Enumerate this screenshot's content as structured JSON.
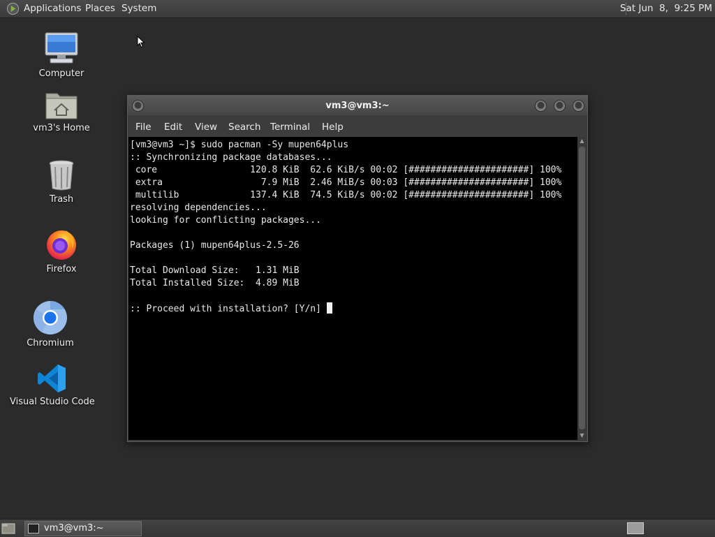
{
  "top_panel": {
    "menus": [
      "Applications",
      "Places",
      "System"
    ],
    "clock": "Sat Jun  8,  9:25 PM"
  },
  "desktop_icons": [
    {
      "label": "Computer",
      "icon": "computer-icon"
    },
    {
      "label": "vm3's Home",
      "icon": "home-folder-icon"
    },
    {
      "label": "Trash",
      "icon": "trash-icon"
    },
    {
      "label": "Firefox",
      "icon": "firefox-icon"
    },
    {
      "label": "Chromium",
      "icon": "chromium-icon"
    },
    {
      "label": "Visual Studio Code",
      "icon": "vscode-icon"
    }
  ],
  "window": {
    "title": "vm3@vm3:~",
    "menu": [
      "File",
      "Edit",
      "View",
      "Search",
      "Terminal",
      "Help"
    ],
    "terminal_lines": [
      "[vm3@vm3 ~]$ sudo pacman -Sy mupen64plus",
      ":: Synchronizing package databases...",
      " core                 120.8 KiB  62.6 KiB/s 00:02 [######################] 100%",
      " extra                  7.9 MiB  2.46 MiB/s 00:03 [######################] 100%",
      " multilib             137.4 KiB  74.5 KiB/s 00:02 [######################] 100%",
      "resolving dependencies...",
      "looking for conflicting packages...",
      "",
      "Packages (1) mupen64plus-2.5-26",
      "",
      "Total Download Size:   1.31 MiB",
      "Total Installed Size:  4.89 MiB",
      "",
      ":: Proceed with installation? [Y/n] "
    ]
  },
  "taskbar": {
    "task_label": "vm3@vm3:~"
  },
  "colors": {
    "desktop": "#2b2b2b",
    "panel": "#3a3a3a",
    "terminal_bg": "#000000",
    "terminal_fg": "#e8e8e8"
  }
}
